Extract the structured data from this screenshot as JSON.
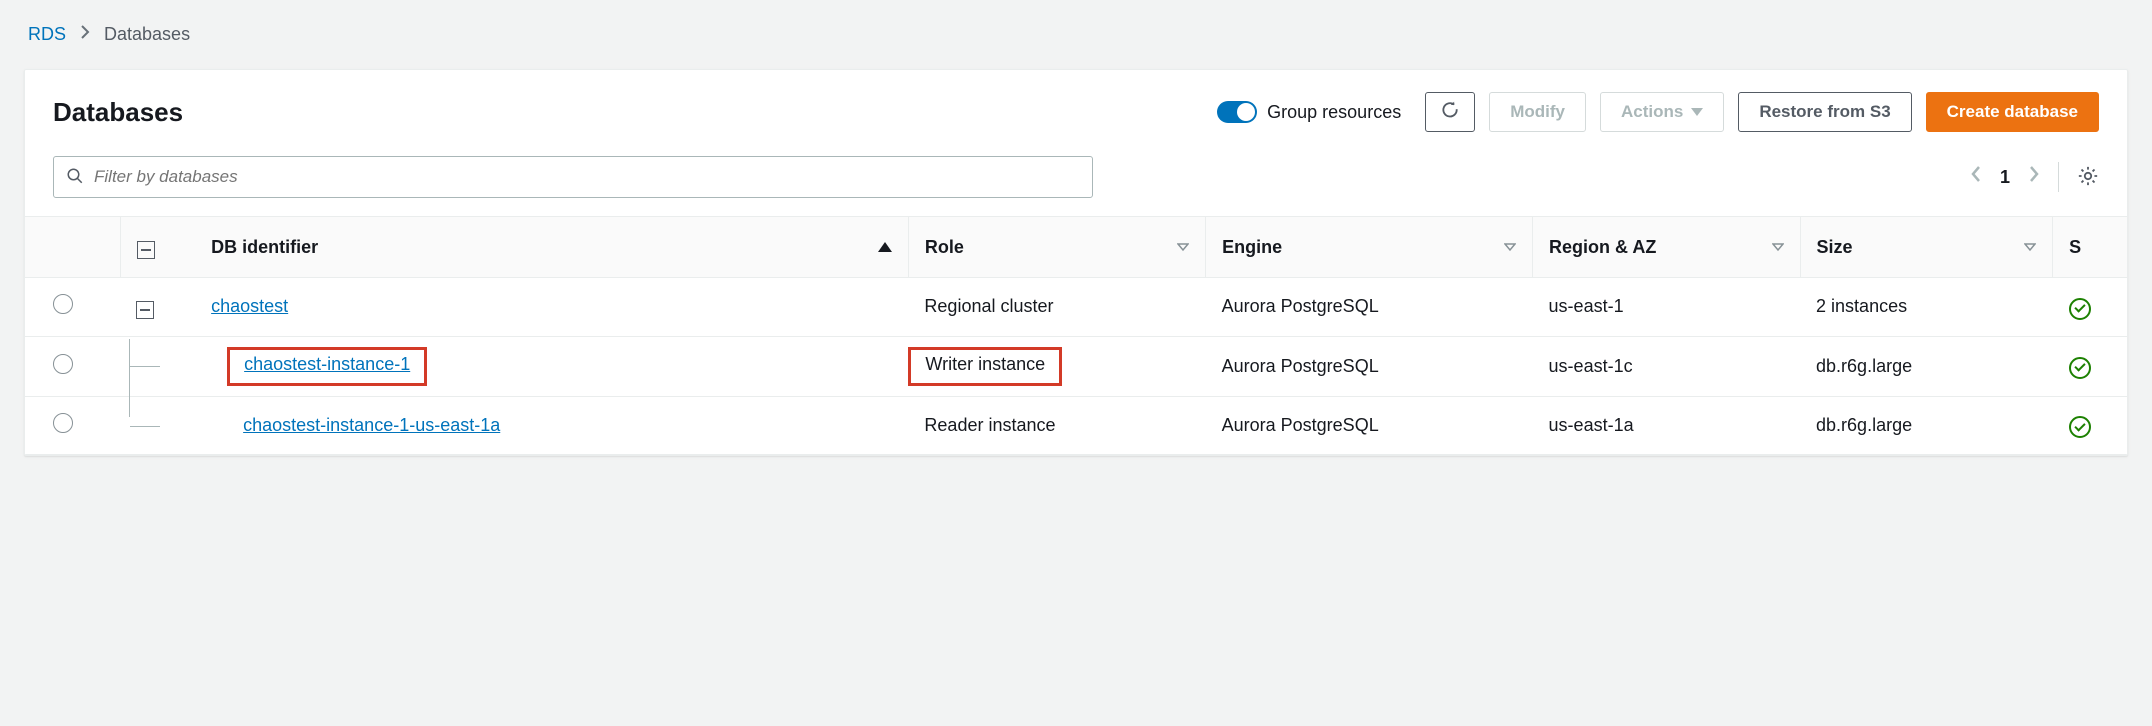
{
  "breadcrumb": {
    "root": "RDS",
    "current": "Databases"
  },
  "header": {
    "title": "Databases",
    "toggle_label": "Group resources",
    "buttons": {
      "modify": "Modify",
      "actions": "Actions",
      "restore_s3": "Restore from S3",
      "create": "Create database"
    }
  },
  "filter": {
    "placeholder": "Filter by databases",
    "page": "1"
  },
  "columns": {
    "db_identifier": "DB identifier",
    "role": "Role",
    "engine": "Engine",
    "region_az": "Region & AZ",
    "size": "Size",
    "status_trunc": "S"
  },
  "rows": [
    {
      "id": "chaostest",
      "role": "Regional cluster",
      "engine": "Aurora PostgreSQL",
      "region": "us-east-1",
      "size": "2 instances",
      "level": 0,
      "highlight_id": false,
      "highlight_role": false
    },
    {
      "id": "chaostest-instance-1",
      "role": "Writer instance",
      "engine": "Aurora PostgreSQL",
      "region": "us-east-1c",
      "size": "db.r6g.large",
      "level": 1,
      "highlight_id": true,
      "highlight_role": true
    },
    {
      "id": "chaostest-instance-1-us-east-1a",
      "role": "Reader instance",
      "engine": "Aurora PostgreSQL",
      "region": "us-east-1a",
      "size": "db.r6g.large",
      "level": 1,
      "highlight_id": false,
      "highlight_role": false
    }
  ]
}
